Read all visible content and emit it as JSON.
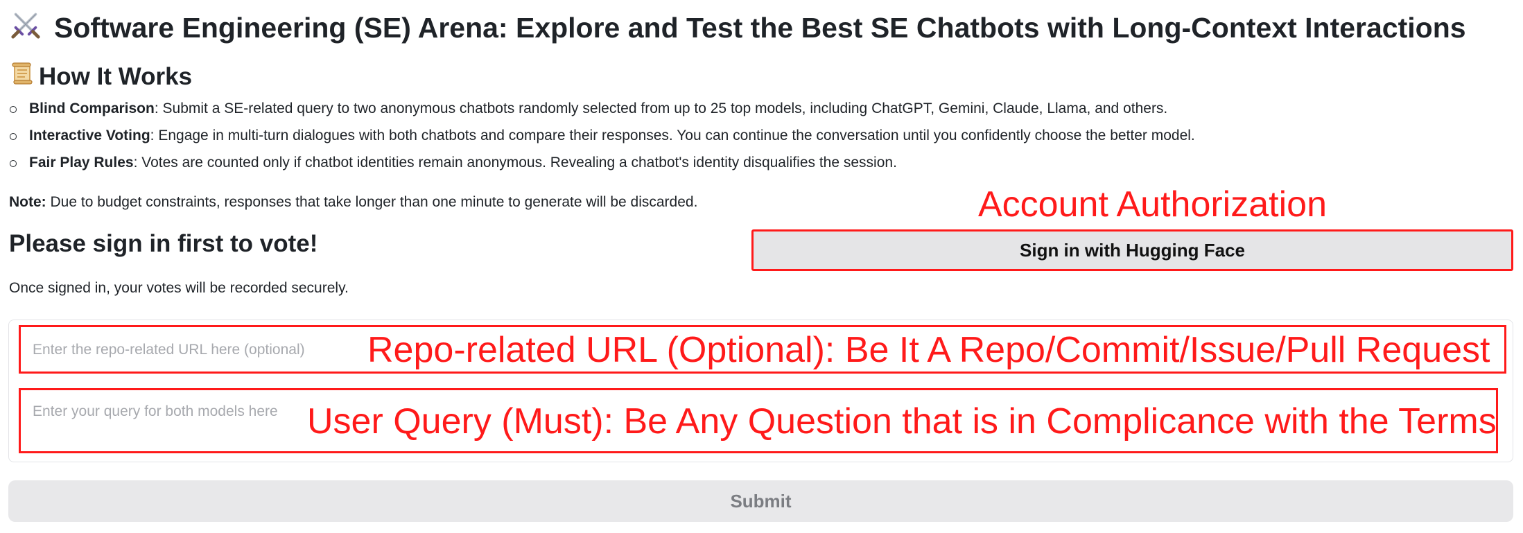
{
  "header": {
    "title_icon": "crossed-swords-icon",
    "title": "Software Engineering (SE) Arena: Explore and Test the Best SE Chatbots with Long-Context Interactions"
  },
  "how_it_works": {
    "icon": "scroll-icon",
    "heading": "How It Works",
    "items": [
      {
        "label": "Blind Comparison",
        "text": ": Submit a SE-related query to two anonymous chatbots randomly selected from up to 25 top models, including ChatGPT, Gemini, Claude, Llama, and others."
      },
      {
        "label": "Interactive Voting",
        "text": ": Engage in multi-turn dialogues with both chatbots and compare their responses. You can continue the conversation until you confidently choose the better model."
      },
      {
        "label": "Fair Play Rules",
        "text": ": Votes are counted only if chatbot identities remain anonymous. Revealing a chatbot's identity disqualifies the session."
      }
    ]
  },
  "note": {
    "label": "Note:",
    "text": " Due to budget constraints, responses that take longer than one minute to generate will be discarded."
  },
  "signin": {
    "heading": "Please sign in first to vote!",
    "description": "Once signed in, your votes will be recorded securely.",
    "button_label": "Sign in with Hugging Face"
  },
  "inputs": {
    "url_placeholder": "Enter the repo-related URL here (optional)",
    "query_placeholder": "Enter your query for both models here"
  },
  "submit": {
    "label": "Submit"
  },
  "annotations": {
    "account": "Account Authorization",
    "url": "Repo-related URL (Optional): Be It A Repo/Commit/Issue/Pull Request",
    "query": "User Query (Must): Be Any Question that is in Complicance with the Terms"
  },
  "colors": {
    "annotation_red": "#ff1a1a",
    "button_gray": "#e5e5e7",
    "submit_disabled": "#e8e8ea",
    "placeholder_gray": "#a7a9ae"
  }
}
